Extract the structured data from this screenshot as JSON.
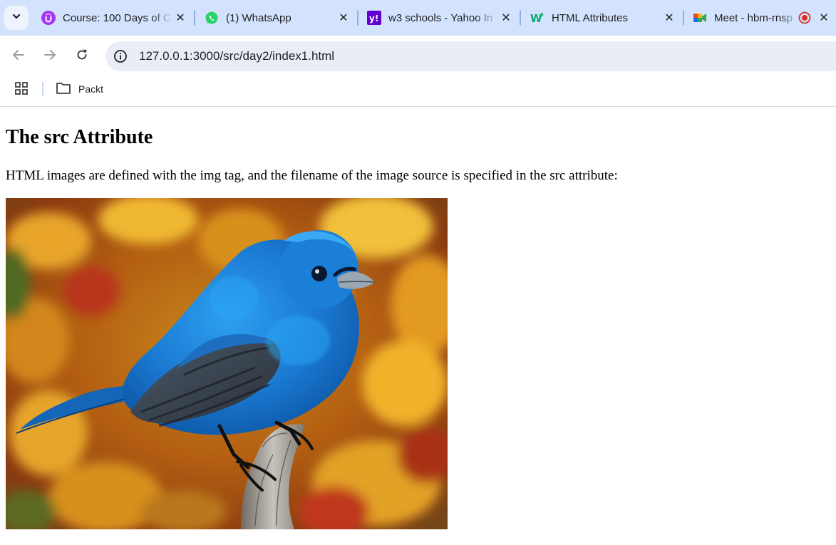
{
  "browser": {
    "tabs": [
      {
        "title": "Course: 100 Days of C",
        "favicon": "udemy-icon"
      },
      {
        "title": "(1) WhatsApp",
        "favicon": "whatsapp-icon"
      },
      {
        "title": "w3 schools - Yahoo In",
        "favicon": "yahoo-icon"
      },
      {
        "title": "HTML Attributes",
        "favicon": "w3schools-icon",
        "active": true
      },
      {
        "title": "Meet - hbm-rnsp",
        "favicon": "google-meet-icon",
        "recording": true
      }
    ],
    "address_bar": {
      "url": "127.0.0.1:3000/src/day2/index1.html"
    },
    "bookmarks": [
      {
        "label": "Packt",
        "icon": "folder-icon"
      }
    ]
  },
  "page": {
    "heading": "The src Attribute",
    "paragraph": "HTML images are defined with the img tag, and the filename of the image source is specified in the src attribute:",
    "image": {
      "subject": "blue-bird-on-branch"
    }
  },
  "colors": {
    "tabstrip_bg": "#d3e3fd",
    "omnibox_bg": "#e9eef6",
    "bird_blue": "#1d7fd6",
    "recording_red": "#d93025"
  }
}
